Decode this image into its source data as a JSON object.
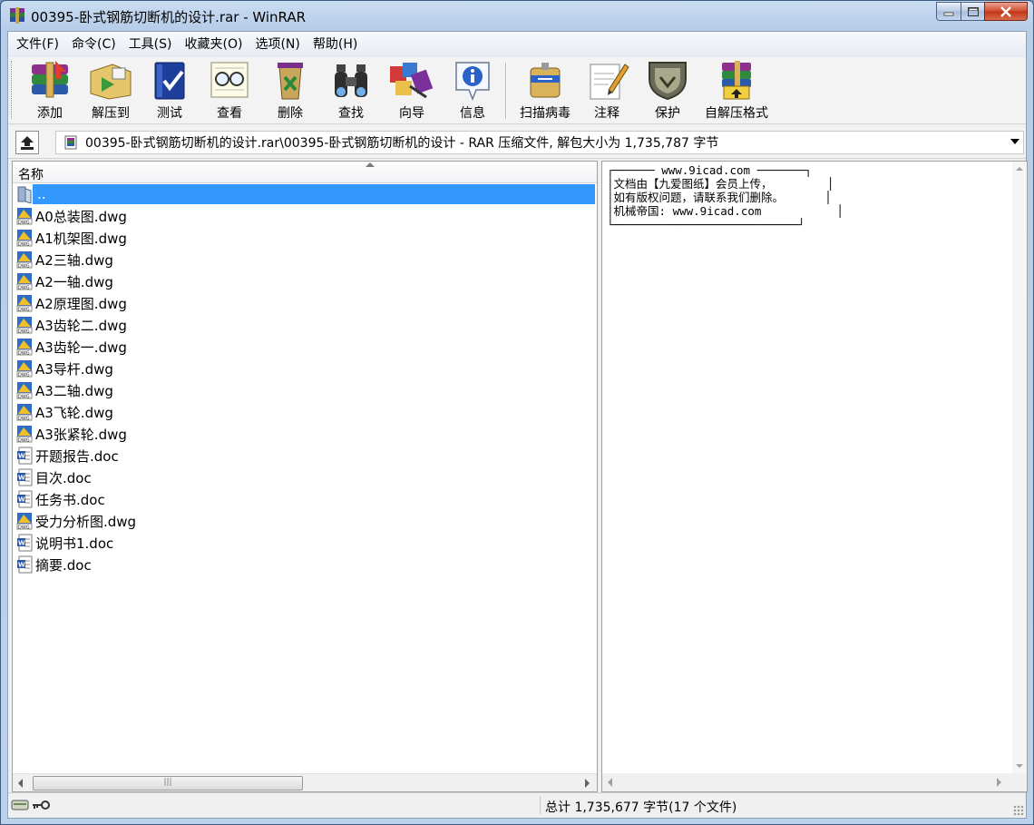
{
  "window": {
    "title": "00395-卧式钢筋切断机的设计.rar - WinRAR"
  },
  "menu": {
    "items": [
      "文件(F)",
      "命令(C)",
      "工具(S)",
      "收藏夹(O)",
      "选项(N)",
      "帮助(H)"
    ]
  },
  "toolbar": {
    "buttons": [
      {
        "label": "添加",
        "icon": "add-archive-icon"
      },
      {
        "label": "解压到",
        "icon": "extract-to-icon"
      },
      {
        "label": "测试",
        "icon": "test-icon"
      },
      {
        "label": "查看",
        "icon": "view-icon"
      },
      {
        "label": "删除",
        "icon": "delete-icon"
      },
      {
        "label": "查找",
        "icon": "find-icon"
      },
      {
        "label": "向导",
        "icon": "wizard-icon"
      },
      {
        "label": "信息",
        "icon": "info-icon"
      },
      {
        "label": "扫描病毒",
        "icon": "virus-scan-icon"
      },
      {
        "label": "注释",
        "icon": "comment-icon"
      },
      {
        "label": "保护",
        "icon": "protect-icon"
      },
      {
        "label": "自解压格式",
        "icon": "sfx-icon"
      }
    ]
  },
  "address": {
    "path": "00395-卧式钢筋切断机的设计.rar\\00395-卧式钢筋切断机的设计 - RAR 压缩文件, 解包大小为 1,735,787 字节"
  },
  "filelist": {
    "column_name": "名称",
    "files": [
      {
        "name": "..",
        "type": "folder-up"
      },
      {
        "name": "A0总装图.dwg",
        "type": "dwg"
      },
      {
        "name": "A1机架图.dwg",
        "type": "dwg"
      },
      {
        "name": "A2三轴.dwg",
        "type": "dwg"
      },
      {
        "name": "A2一轴.dwg",
        "type": "dwg"
      },
      {
        "name": "A2原理图.dwg",
        "type": "dwg"
      },
      {
        "name": "A3齿轮二.dwg",
        "type": "dwg"
      },
      {
        "name": "A3齿轮一.dwg",
        "type": "dwg"
      },
      {
        "name": "A3导杆.dwg",
        "type": "dwg"
      },
      {
        "name": "A3二轴.dwg",
        "type": "dwg"
      },
      {
        "name": "A3飞轮.dwg",
        "type": "dwg"
      },
      {
        "name": "A3张紧轮.dwg",
        "type": "dwg"
      },
      {
        "name": "开题报告.doc",
        "type": "doc"
      },
      {
        "name": "目次.doc",
        "type": "doc"
      },
      {
        "name": "任务书.doc",
        "type": "doc"
      },
      {
        "name": "受力分析图.dwg",
        "type": "dwg"
      },
      {
        "name": "说明书1.doc",
        "type": "doc"
      },
      {
        "name": "摘要.doc",
        "type": "doc"
      }
    ],
    "selected_index": 0
  },
  "comment": {
    "lines": [
      "┌────── www.9icad.com ───────┐",
      "│文档由【九爱图纸】会员上传，        │",
      "│如有版权问题，请联系我们删除。      │",
      "│机械帝国: www.9icad.com           │",
      "└───────────────────────────┘"
    ]
  },
  "status": {
    "total": "总计 1,735,677 字节(17 个文件)"
  },
  "colors": {
    "selection": "#3399ff",
    "title_bar": "#c9dcf2",
    "close_button": "#c8452a"
  }
}
